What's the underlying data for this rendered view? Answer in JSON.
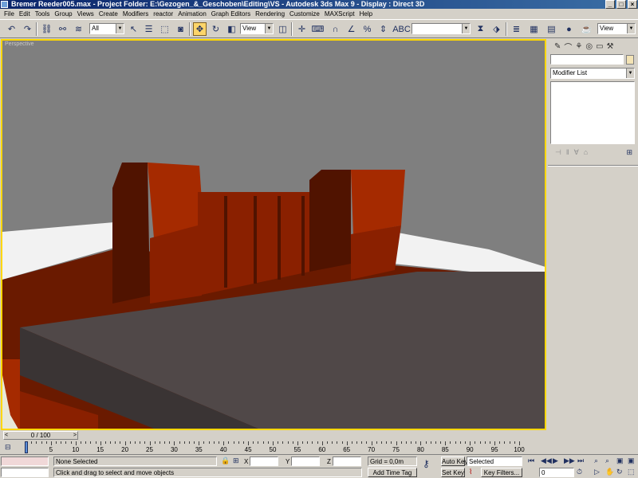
{
  "window": {
    "title": "Bremer Reeder005.max    - Project Folder: E:\\Gezogen_&_Geschoben\\Editing\\VS     - Autodesk 3ds Max 9     - Display : Direct 3D"
  },
  "menu": [
    "File",
    "Edit",
    "Tools",
    "Group",
    "Views",
    "Create",
    "Modifiers",
    "reactor",
    "Animation",
    "Graph Editors",
    "Rendering",
    "Customize",
    "MAXScript",
    "Help"
  ],
  "toolbar": {
    "selection_filter": "All",
    "ref_coord_system": "View",
    "named_selection": "",
    "right_view_dropdown": "View"
  },
  "viewport": {
    "label": "Perspective",
    "active_border_color": "#ffd700"
  },
  "command_panel": {
    "modifier_list": "Modifier List",
    "swatch_color": "#f3e3b4"
  },
  "timeline": {
    "slider_label": "0 / 100",
    "ticks": [
      0,
      5,
      10,
      15,
      20,
      25,
      30,
      35,
      40,
      45,
      50,
      55,
      60,
      65,
      70,
      75,
      80,
      85,
      90,
      95,
      100
    ]
  },
  "status": {
    "selection": "None Selected",
    "prompt": "Click and drag to select and move objects",
    "x_label": "X",
    "y_label": "Y",
    "z_label": "Z",
    "grid": "Grid = 0,0m",
    "add_time_tag": "Add Time Tag",
    "auto_key": "Auto Key",
    "set_key": "Set Key",
    "key_mode": "Selected",
    "key_filters": "Key Filters...",
    "current_frame": "0"
  }
}
